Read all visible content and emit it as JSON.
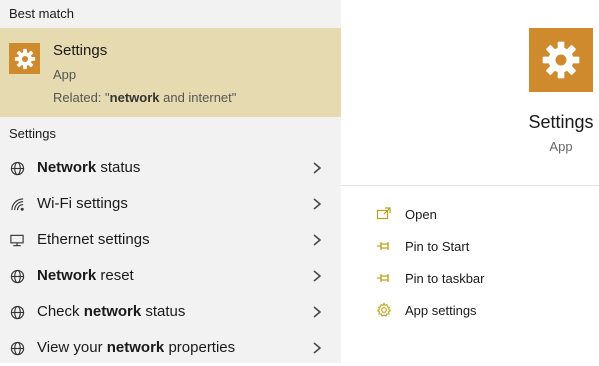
{
  "best_match": {
    "header": "Best match",
    "title": "Settings",
    "type": "App",
    "related_prefix": "Related: \"",
    "related_bold": "network",
    "related_suffix": " and internet\""
  },
  "settings_section": {
    "header": "Settings",
    "items": [
      {
        "icon": "globe-icon",
        "pre": "",
        "bold": "Network",
        "post": " status"
      },
      {
        "icon": "wifi-icon",
        "pre": "Wi-Fi settings",
        "bold": "",
        "post": ""
      },
      {
        "icon": "ethernet-icon",
        "pre": "Ethernet settings",
        "bold": "",
        "post": ""
      },
      {
        "icon": "globe-icon",
        "pre": "",
        "bold": "Network",
        "post": " reset"
      },
      {
        "icon": "globe-icon",
        "pre": "Check ",
        "bold": "network",
        "post": " status"
      },
      {
        "icon": "globe-icon",
        "pre": "View your ",
        "bold": "network",
        "post": " properties"
      }
    ]
  },
  "detail": {
    "title": "Settings",
    "type": "App",
    "actions": [
      {
        "icon": "open-icon",
        "label": "Open"
      },
      {
        "icon": "pin-icon",
        "label": "Pin to Start"
      },
      {
        "icon": "pin-icon",
        "label": "Pin to taskbar"
      },
      {
        "icon": "gear-icon",
        "label": "App settings"
      }
    ]
  },
  "colors": {
    "accent": "#cf8a2e",
    "selected_bg": "#e6dbb0",
    "pane_bg": "#f2f2f2"
  }
}
